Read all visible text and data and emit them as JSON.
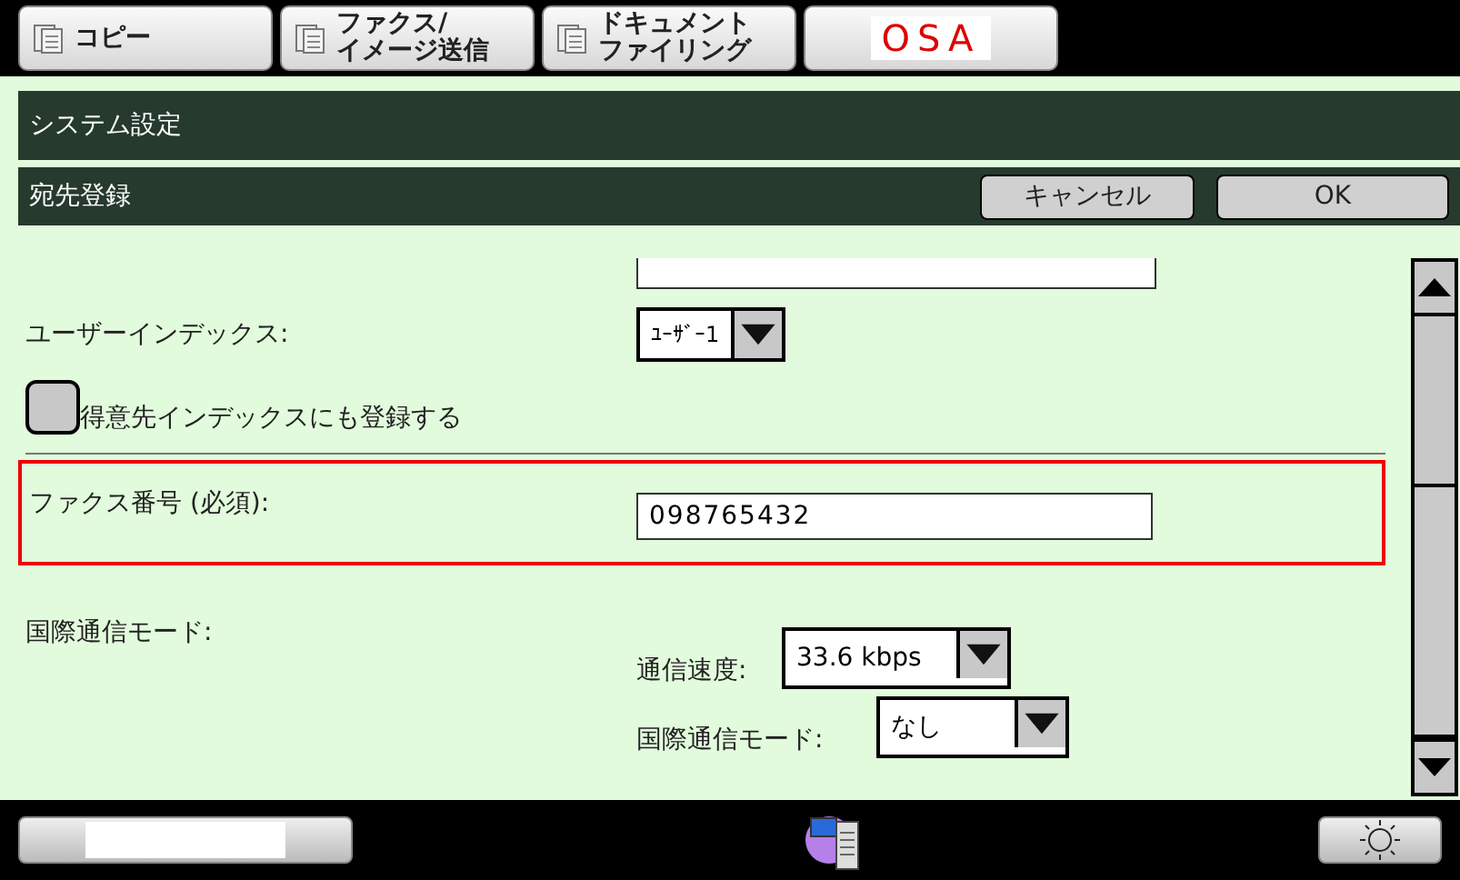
{
  "tabs": [
    {
      "kind": "app",
      "lines": [
        "コピー"
      ]
    },
    {
      "kind": "app",
      "lines": [
        "ファクス/",
        "イメージ送信"
      ]
    },
    {
      "kind": "app",
      "lines": [
        "ドキュメント",
        "ファイリング"
      ]
    },
    {
      "kind": "logo",
      "lines": [
        "OSA"
      ]
    }
  ],
  "title_bar": {
    "title": "システム設定"
  },
  "sub_bar": {
    "title": "宛先登録",
    "buttons": [
      "キャンセル",
      "OK"
    ]
  },
  "user_index": {
    "label": "ユーザーインデックス:",
    "value": "ﾕｰｻﾞｰ1"
  },
  "register_checkbox": {
    "label": "得意先インデックスにも登録する",
    "checked": false
  },
  "fax_number": {
    "label": "ファクス番号 (必須):",
    "value": "098765432",
    "highlighted": true
  },
  "international_mode": {
    "label": "国際通信モード:",
    "speed": {
      "label": "通信速度:",
      "value": "33.6 kbps"
    },
    "mode": {
      "label": "国際通信モード:",
      "value": "なし"
    }
  }
}
